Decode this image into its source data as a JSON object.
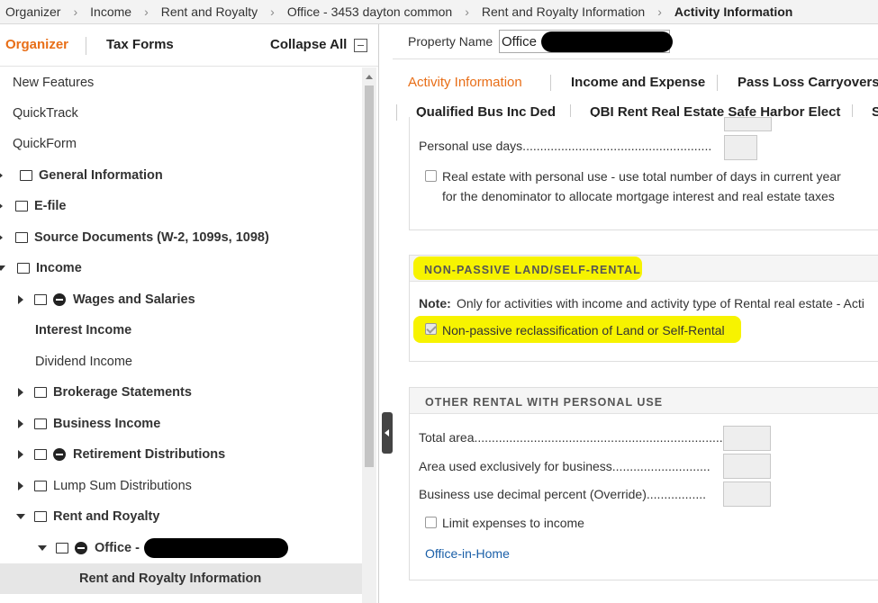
{
  "breadcrumb": {
    "items": [
      "Organizer",
      "Income",
      "Rent and Royalty",
      "Office - 3453 dayton common",
      "Rent and Royalty Information",
      "Activity Information"
    ]
  },
  "left_panel": {
    "tab_organizer": "Organizer",
    "tab_taxforms": "Tax Forms",
    "collapse_all": "Collapse All",
    "tree": [
      {
        "label": "New Features"
      },
      {
        "label": "QuickTrack"
      },
      {
        "label": "QuickForm"
      },
      {
        "label": "General Information"
      },
      {
        "label": "E-file"
      },
      {
        "label": "Source Documents (W-2, 1099s, 1098)"
      },
      {
        "label": "Income"
      },
      {
        "label": "Wages and Salaries"
      },
      {
        "label": "Interest Income"
      },
      {
        "label": "Dividend Income"
      },
      {
        "label": "Brokerage Statements"
      },
      {
        "label": "Business Income"
      },
      {
        "label": "Retirement Distributions"
      },
      {
        "label": "Lump Sum Distributions"
      },
      {
        "label": "Rent and Royalty"
      },
      {
        "label": "Office -"
      },
      {
        "label": "Rent and Royalty Information"
      }
    ]
  },
  "right_panel": {
    "property_name_label": "Property Name",
    "property_name_value": "Office",
    "tabs": [
      "Activity Information",
      "Income and Expense",
      "Pass Loss Carryovers",
      "Qualified Bus Inc Ded",
      "QBI Rent Real Estate Safe Harbor Elect",
      "S"
    ],
    "personal_use": {
      "personal_use_days": "Personal use days......................................................",
      "real_estate_line1": "Real estate with personal use - use total number of days in current year",
      "real_estate_line2": "for the denominator to allocate mortgage interest and real estate taxes"
    },
    "nonpassive": {
      "title": "NON-PASSIVE LAND/SELF-RENTAL",
      "note_label": "Note:",
      "note_text": "Only for activities with income and activity type of Rental real estate - Acti",
      "checkbox_label": "Non-passive reclassification of Land or Self-Rental",
      "checked": true
    },
    "other_rental": {
      "title": "OTHER RENTAL WITH PERSONAL USE",
      "total_area": "Total area...............................................................................",
      "area_business": "Area used exclusively for business............................",
      "business_pct": "Business use decimal percent (Override).................",
      "limit_expenses": "Limit expenses to income",
      "link": "Office-in-Home"
    }
  },
  "colors": {
    "accent": "#e86e17",
    "link": "#1a5fa8",
    "highlight": "#f7f300"
  }
}
